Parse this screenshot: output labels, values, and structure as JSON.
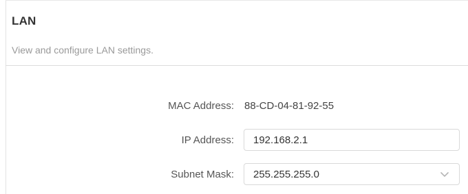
{
  "section": {
    "title": "LAN",
    "description": "View and configure LAN settings."
  },
  "fields": {
    "mac": {
      "label": "MAC Address:",
      "value": "88-CD-04-81-92-55"
    },
    "ip": {
      "label": "IP Address:",
      "value": "192.168.2.1"
    },
    "subnet": {
      "label": "Subnet Mask:",
      "value": "255.255.255.0",
      "icon": "chevron-down-icon"
    }
  },
  "colors": {
    "label_text": "#555555",
    "muted_text": "#999999",
    "field_border": "#d9d9d9",
    "divider": "#dcdcdc"
  }
}
